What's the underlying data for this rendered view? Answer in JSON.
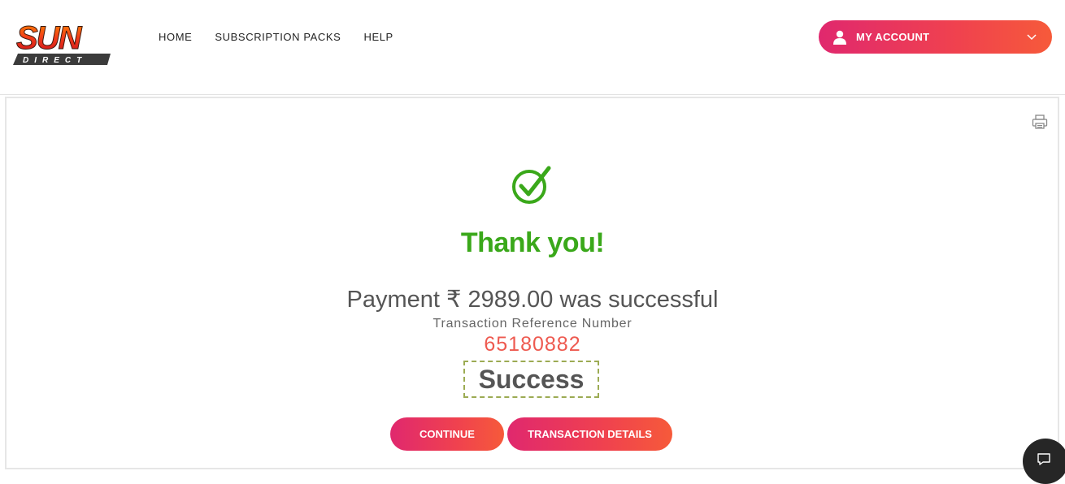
{
  "brand": {
    "logo_text_top": "SUN",
    "logo_text_bottom": "DIRECT"
  },
  "nav": {
    "items": [
      {
        "label": "HOME"
      },
      {
        "label": "SUBSCRIPTION PACKS"
      },
      {
        "label": "HELP"
      }
    ]
  },
  "account": {
    "label": "MY ACCOUNT",
    "icon": "user-icon"
  },
  "result": {
    "heading": "Thank you!",
    "payment_message": "Payment ₹ 2989.00 was successful",
    "ref_label": "Transaction Reference Number",
    "ref_number": "65180882",
    "status": "Success"
  },
  "actions": {
    "continue_label": "CONTINUE",
    "details_label": "TRANSACTION DETAILS"
  },
  "icons": [
    "print-icon",
    "check-circle-icon",
    "chat-icon",
    "chevron-down-icon"
  ],
  "colors": {
    "accent_gradient_start": "#e0286e",
    "accent_gradient_end": "#f65a3a",
    "success_green": "#3aa81a",
    "ref_number": "#ee5a50"
  }
}
